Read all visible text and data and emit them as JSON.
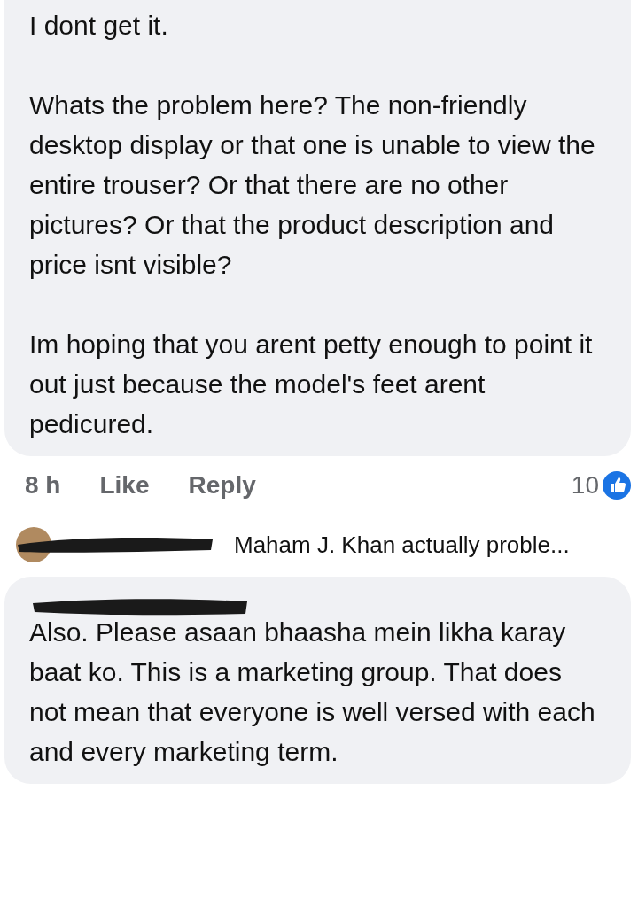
{
  "comment": {
    "paragraphs": [
      "I dont get it.",
      "Whats the problem here? The non-friendly desktop display or that one is unable to view the entire trouser? Or that there are no other pictures? Or that the product description and price isnt visible?",
      "Im hoping that you arent petty enough to point it out just because the model's feet arent pedicured."
    ]
  },
  "actions": {
    "time": "8 h",
    "like": "Like",
    "reply": "Reply",
    "reaction_count": "10"
  },
  "reply_preview": {
    "text": "Maham J. Khan actually proble..."
  },
  "second_comment": {
    "paragraphs": [
      "Also. Please asaan bhaasha mein likha karay baat ko. This is a marketing group. That does not mean that everyone is well versed with each and every marketing term."
    ]
  }
}
